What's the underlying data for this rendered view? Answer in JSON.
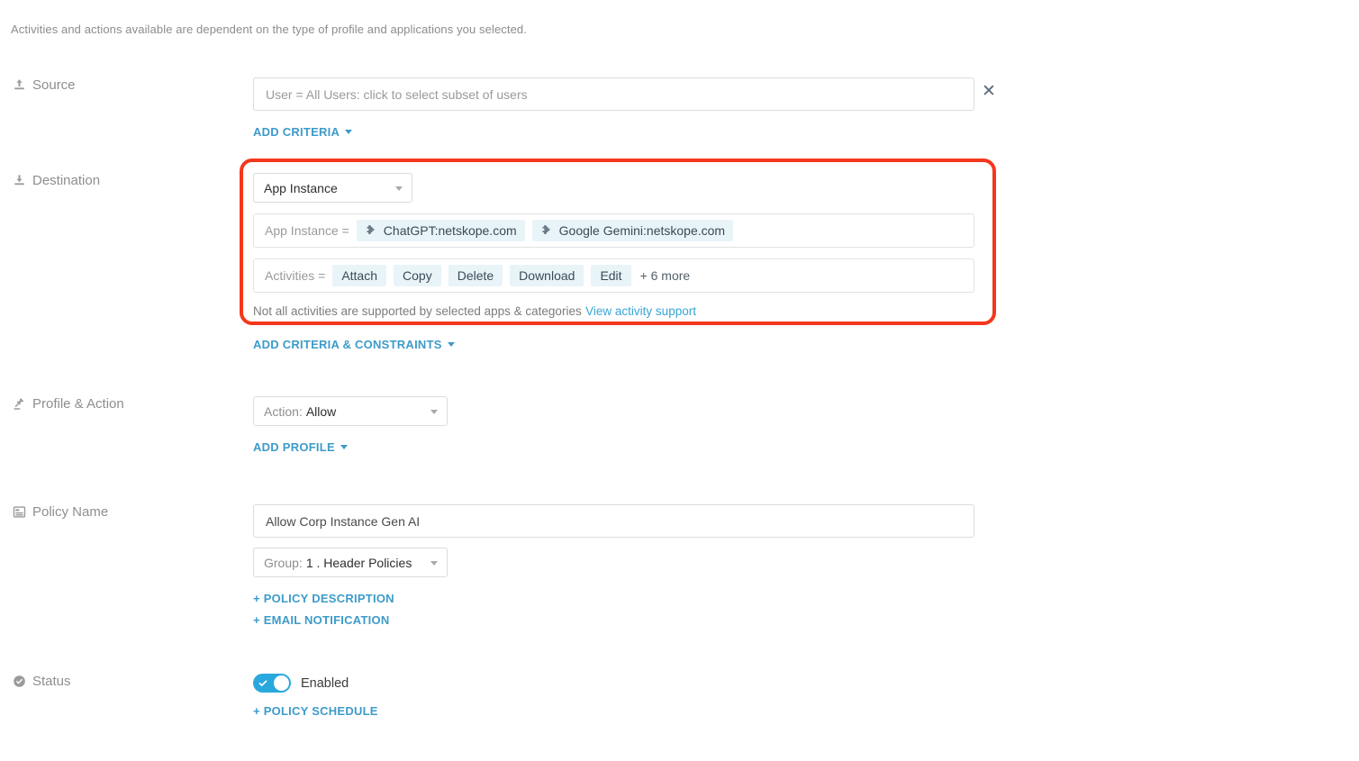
{
  "hint": "Activities and actions available are dependent on the type of profile and applications you selected.",
  "colors": {
    "accent_link": "#3d9bc9",
    "highlight_box": "#f4371c",
    "chip_bg": "#e8f4f8",
    "toggle_on": "#29a8dd"
  },
  "sections": {
    "source": {
      "label": "Source",
      "icon": "upload-icon",
      "criteria_value": "User = All Users: click to select subset of users",
      "remove_icon": "close-icon",
      "add_link": "ADD CRITERIA"
    },
    "destination": {
      "label": "Destination",
      "icon": "download-icon",
      "type_select": {
        "value": "App Instance",
        "caret_icon": "chevron-down-icon"
      },
      "app_instance_row": {
        "key": "App Instance =",
        "chips": [
          {
            "icon": "puzzle-piece-icon",
            "label": "ChatGPT:netskope.com"
          },
          {
            "icon": "puzzle-piece-icon",
            "label": "Google Gemini:netskope.com"
          }
        ]
      },
      "activities_row": {
        "key": "Activities =",
        "chips": [
          {
            "label": "Attach"
          },
          {
            "label": "Copy"
          },
          {
            "label": "Delete"
          },
          {
            "label": "Download"
          },
          {
            "label": "Edit"
          }
        ],
        "more": "+ 6 more"
      },
      "support_note": "Not all activities are supported by selected apps & categories",
      "support_link": "View activity support",
      "add_link": "ADD CRITERIA & CONSTRAINTS"
    },
    "profile_action": {
      "label": "Profile & Action",
      "icon": "gavel-icon",
      "action_select": {
        "prefix": "Action:",
        "value": "Allow",
        "caret_icon": "chevron-down-icon"
      },
      "add_link": "ADD PROFILE"
    },
    "policy_name": {
      "label": "Policy Name",
      "icon": "form-icon",
      "name_value": "Allow Corp Instance Gen AI",
      "group_select": {
        "prefix": "Group:",
        "value": "1 . Header Policies",
        "caret_icon": "chevron-down-icon"
      },
      "policy_description_link": "+ POLICY DESCRIPTION",
      "email_notification_link": "+ EMAIL NOTIFICATION"
    },
    "status": {
      "label": "Status",
      "icon": "check-circle-icon",
      "toggle": {
        "state": "on",
        "label": "Enabled",
        "check_icon": "check-icon"
      },
      "schedule_link": "+ POLICY SCHEDULE"
    }
  }
}
